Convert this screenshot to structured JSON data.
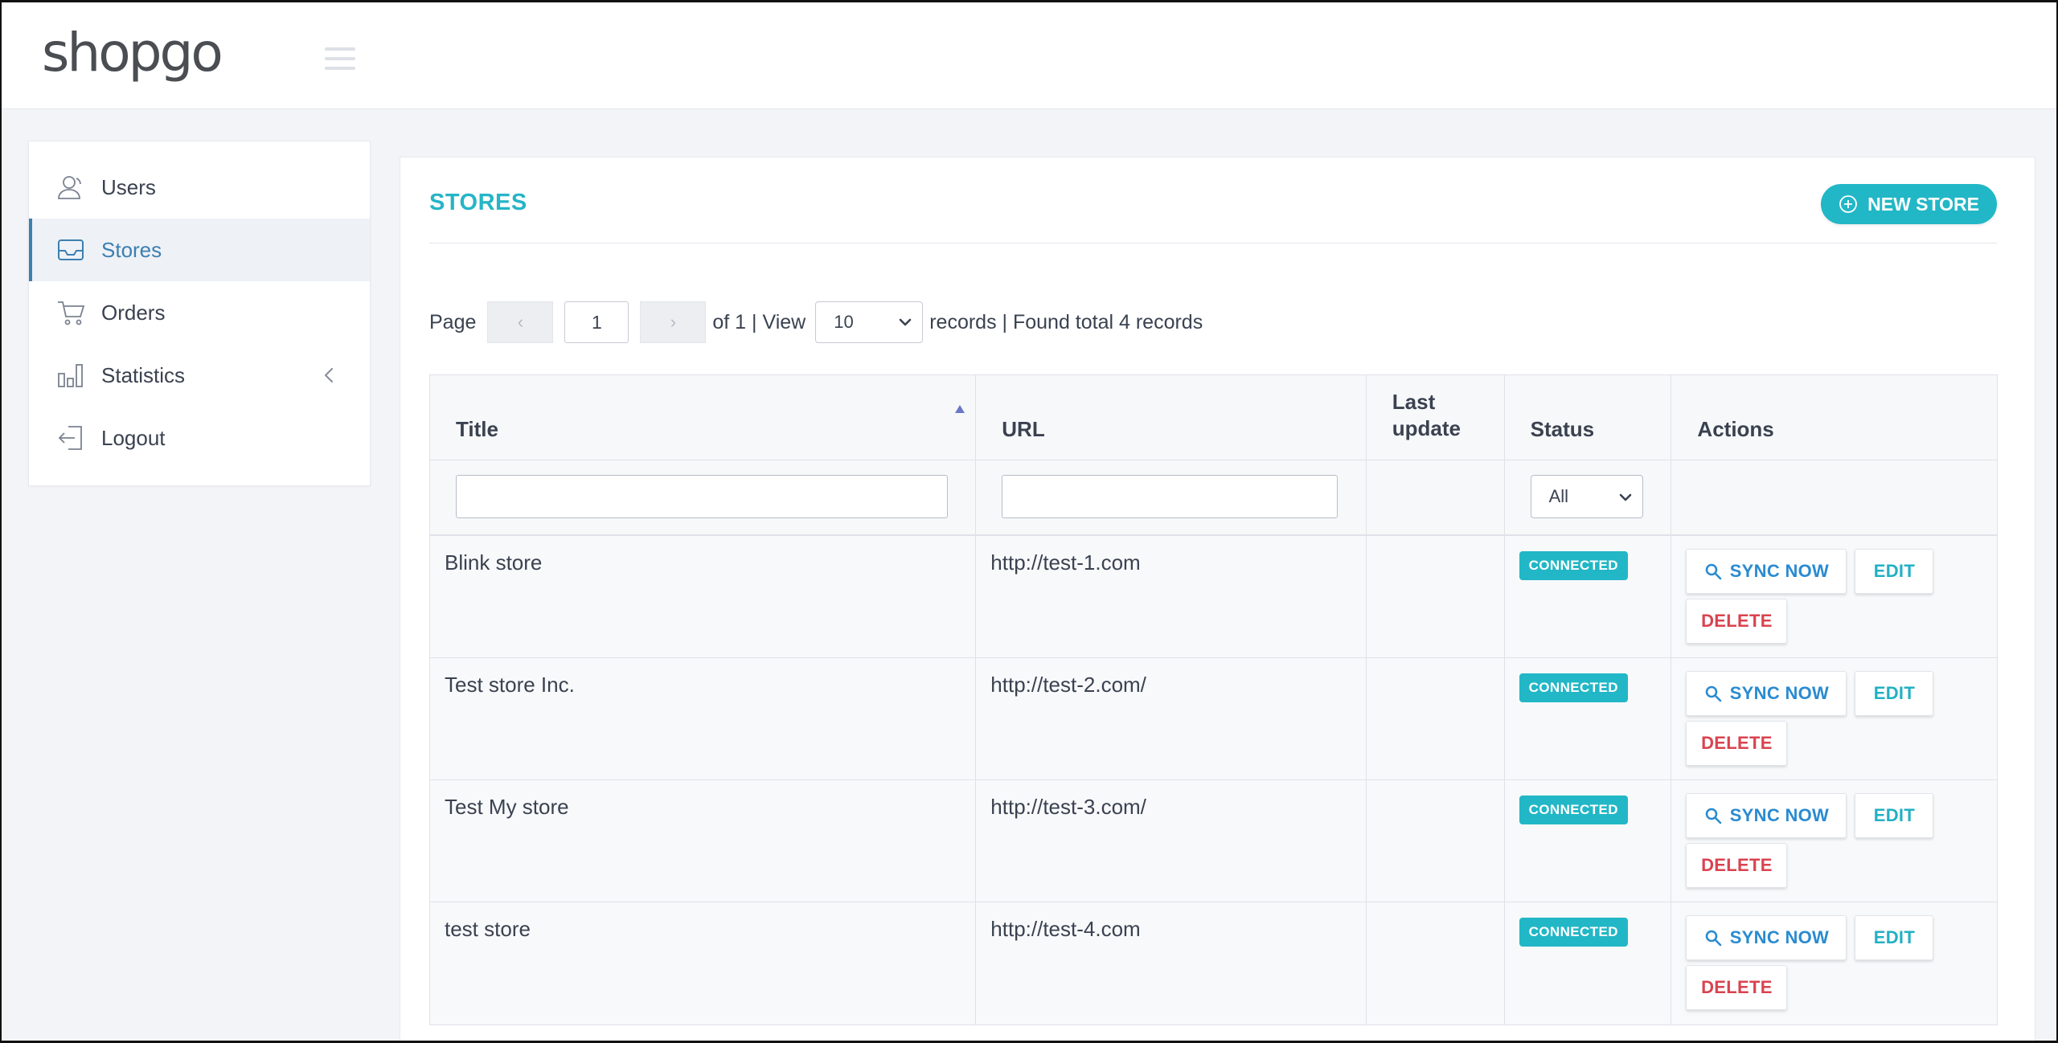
{
  "header": {
    "logo_text": "shopgo"
  },
  "sidebar": {
    "items": [
      {
        "label": "Users",
        "icon": "users-icon"
      },
      {
        "label": "Stores",
        "icon": "inbox-icon",
        "active": true
      },
      {
        "label": "Orders",
        "icon": "cart-icon"
      },
      {
        "label": "Statistics",
        "icon": "bar-chart-icon",
        "has_submenu": true
      },
      {
        "label": "Logout",
        "icon": "logout-icon"
      }
    ]
  },
  "main": {
    "title": "STORES",
    "new_store_label": "NEW STORE",
    "pager": {
      "page_label": "Page",
      "prev_label": "‹",
      "next_label": "›",
      "current_page": "1",
      "of_label": "of 1 | View",
      "per_page": "10",
      "records_label": "records | Found total 4 records"
    },
    "table": {
      "columns": {
        "title": "Title",
        "url": "URL",
        "last_update": "Last update",
        "status": "Status",
        "actions": "Actions"
      },
      "status_filter": "All",
      "rows": [
        {
          "title": "Blink store",
          "url": "http://test-1.com",
          "last_update": "",
          "status": "CONNECTED"
        },
        {
          "title": "Test store Inc.",
          "url": "http://test-2.com/",
          "last_update": "",
          "status": "CONNECTED"
        },
        {
          "title": "Test My store",
          "url": "http://test-3.com/",
          "last_update": "",
          "status": "CONNECTED"
        },
        {
          "title": "test store",
          "url": "http://test-4.com",
          "last_update": "",
          "status": "CONNECTED"
        }
      ],
      "actions": {
        "sync_label": "SYNC NOW",
        "edit_label": "EDIT",
        "delete_label": "DELETE"
      }
    }
  },
  "colors": {
    "accent": "#22b7c6",
    "active_nav": "#3c7fb1",
    "sync": "#2a8bd0",
    "delete": "#d9434f"
  }
}
